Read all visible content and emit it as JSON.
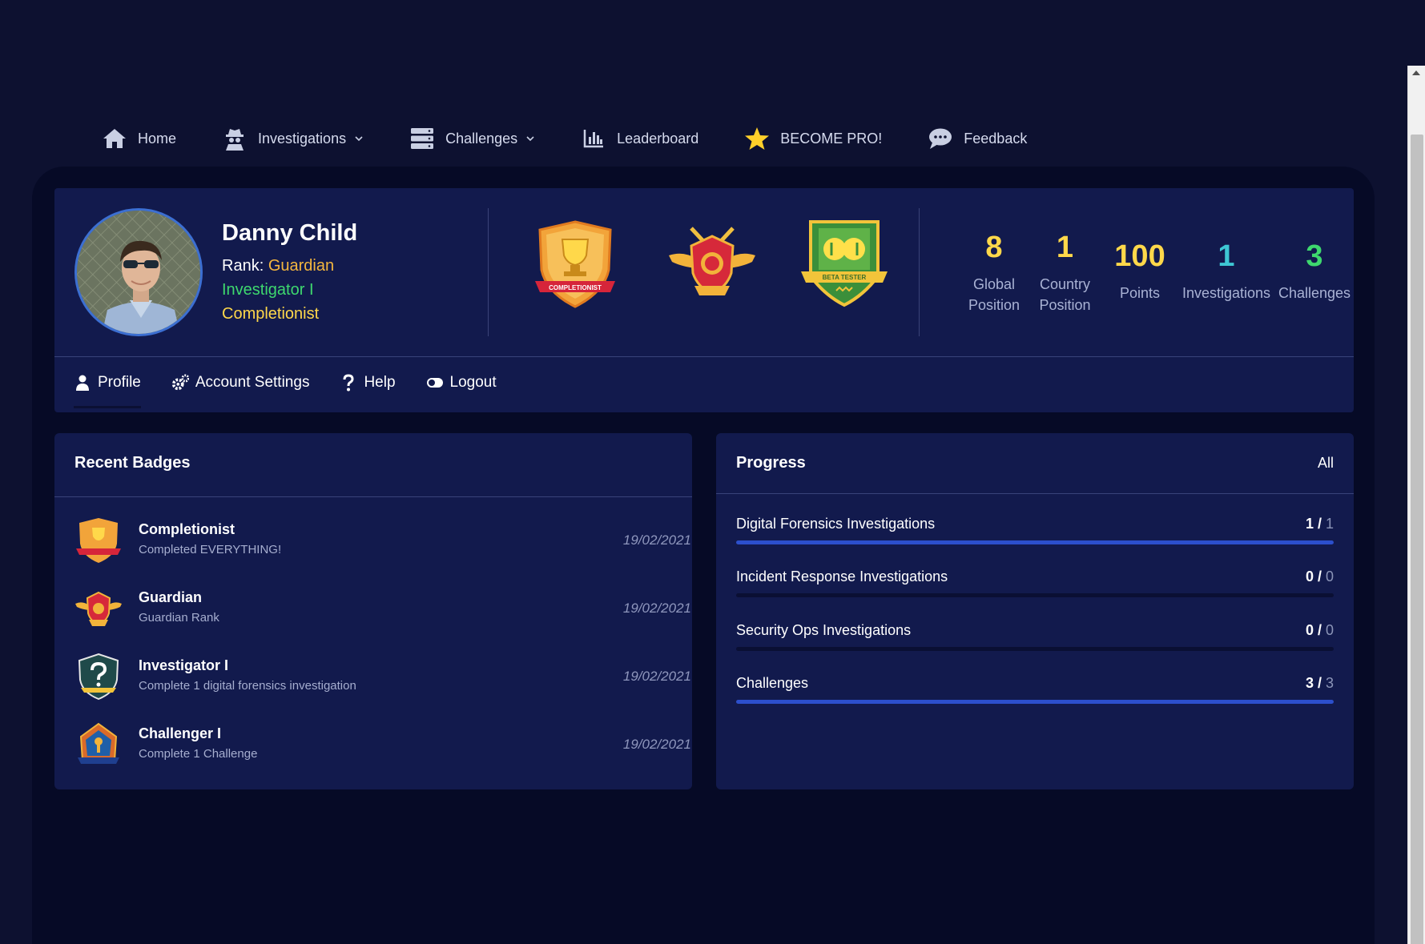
{
  "nav": {
    "items": [
      {
        "label": "Home",
        "icon": "home-icon",
        "has_caret": false
      },
      {
        "label": "Investigations",
        "icon": "spy-icon",
        "has_caret": true
      },
      {
        "label": "Challenges",
        "icon": "server-icon",
        "has_caret": true
      },
      {
        "label": "Leaderboard",
        "icon": "bar-chart-icon",
        "has_caret": false
      },
      {
        "label": "BECOME PRO!",
        "icon": "star-icon",
        "has_caret": false
      },
      {
        "label": "Feedback",
        "icon": "chat-icon",
        "has_caret": false
      }
    ]
  },
  "profile": {
    "name": "Danny Child",
    "rank_label": "Rank:",
    "rank_value": "Guardian",
    "title_1": "Investigator I",
    "title_2": "Completionist",
    "featured_badges": [
      "completionist-badge",
      "guardian-badge",
      "beta-tester-badge"
    ],
    "badge_texts": {
      "completionist": "COMPLETIONIST",
      "beta": "BETA TESTER"
    }
  },
  "stats": [
    {
      "value": "8",
      "label_1": "Global",
      "label_2": "Position",
      "color": "#ffd84a"
    },
    {
      "value": "1",
      "label_1": "Country",
      "label_2": "Position",
      "color": "#ffd84a"
    },
    {
      "value": "100",
      "label_1": "Points",
      "label_2": "",
      "color": "#ffd84a"
    },
    {
      "value": "1",
      "label_1": "Investigations",
      "label_2": "",
      "color": "#3ec7d4"
    },
    {
      "value": "3",
      "label_1": "Challenges",
      "label_2": "",
      "color": "#3ed86e"
    }
  ],
  "subnav": [
    {
      "label": "Profile",
      "icon": "user-icon"
    },
    {
      "label": "Account Settings",
      "icon": "gears-icon"
    },
    {
      "label": "Help",
      "icon": "question-icon"
    },
    {
      "label": "Logout",
      "icon": "toggle-icon"
    }
  ],
  "recent_badges": {
    "title": "Recent Badges",
    "items": [
      {
        "name": "Completionist",
        "desc": "Completed EVERYTHING!",
        "date": "19/02/2021",
        "icon": "completionist-badge-icon"
      },
      {
        "name": "Guardian",
        "desc": "Guardian Rank",
        "date": "19/02/2021",
        "icon": "guardian-badge-icon"
      },
      {
        "name": "Investigator I",
        "desc": "Complete 1 digital forensics investigation",
        "date": "19/02/2021",
        "icon": "investigator-badge-icon"
      },
      {
        "name": "Challenger I",
        "desc": "Complete 1 Challenge",
        "date": "19/02/2021",
        "icon": "challenger-badge-icon"
      }
    ]
  },
  "progress": {
    "title": "Progress",
    "filter": "All",
    "rows": [
      {
        "label": "Digital Forensics Investigations",
        "done": "1",
        "total": "1",
        "fraction": 1
      },
      {
        "label": "Incident Response Investigations",
        "done": "0",
        "total": "0",
        "fraction": 0
      },
      {
        "label": "Security Ops Investigations",
        "done": "0",
        "total": "0",
        "fraction": 0
      },
      {
        "label": "Challenges",
        "done": "3",
        "total": "3",
        "fraction": 1
      }
    ]
  },
  "colors": {
    "accent_blue": "#2c4fcc",
    "gold": "#ffd84a",
    "green": "#3ed86e",
    "teal": "#3ec7d4",
    "orange": "#f4b63f"
  }
}
